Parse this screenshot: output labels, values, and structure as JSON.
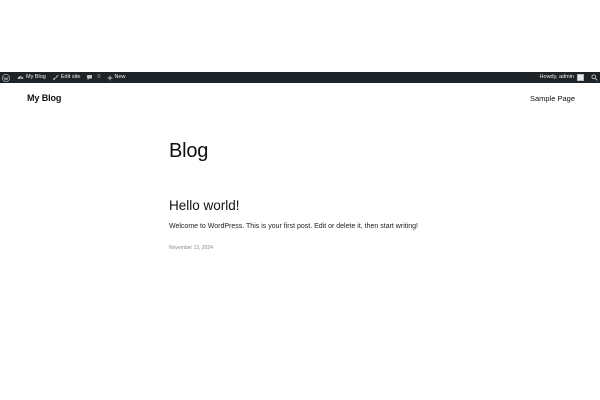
{
  "admin_bar": {
    "my_blog_label": "My Blog",
    "edit_site_label": "Edit site",
    "comments_count": "0",
    "new_label": "New",
    "howdy_label": "Howdy, admin",
    "icons": {
      "wp": "wordpress-logo-icon",
      "site": "dashboard-gauge-icon",
      "edit": "brush-icon",
      "comments": "speech-bubble-icon",
      "new": "plus-icon",
      "search": "search-icon"
    },
    "colors": {
      "background": "#1d2327",
      "text": "#f0f0f1"
    }
  },
  "header": {
    "site_title": "My Blog",
    "nav": [
      "Sample Page"
    ]
  },
  "main": {
    "heading": "Blog",
    "posts": [
      {
        "title": "Hello world!",
        "excerpt": "Welcome to WordPress. This is your first post. Edit or delete it, then start writing!",
        "date": "November 13, 2024"
      }
    ]
  }
}
